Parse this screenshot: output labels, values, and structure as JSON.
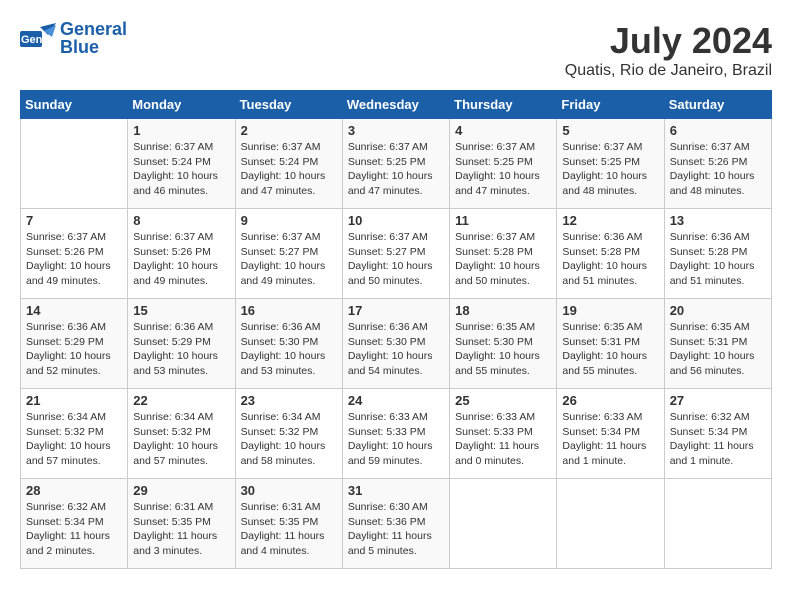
{
  "header": {
    "logo_line1": "General",
    "logo_line2": "Blue",
    "month_year": "July 2024",
    "location": "Quatis, Rio de Janeiro, Brazil"
  },
  "days_of_week": [
    "Sunday",
    "Monday",
    "Tuesday",
    "Wednesday",
    "Thursday",
    "Friday",
    "Saturday"
  ],
  "weeks": [
    [
      {
        "day": "",
        "info": ""
      },
      {
        "day": "1",
        "info": "Sunrise: 6:37 AM\nSunset: 5:24 PM\nDaylight: 10 hours\nand 46 minutes."
      },
      {
        "day": "2",
        "info": "Sunrise: 6:37 AM\nSunset: 5:24 PM\nDaylight: 10 hours\nand 47 minutes."
      },
      {
        "day": "3",
        "info": "Sunrise: 6:37 AM\nSunset: 5:25 PM\nDaylight: 10 hours\nand 47 minutes."
      },
      {
        "day": "4",
        "info": "Sunrise: 6:37 AM\nSunset: 5:25 PM\nDaylight: 10 hours\nand 47 minutes."
      },
      {
        "day": "5",
        "info": "Sunrise: 6:37 AM\nSunset: 5:25 PM\nDaylight: 10 hours\nand 48 minutes."
      },
      {
        "day": "6",
        "info": "Sunrise: 6:37 AM\nSunset: 5:26 PM\nDaylight: 10 hours\nand 48 minutes."
      }
    ],
    [
      {
        "day": "7",
        "info": "Sunrise: 6:37 AM\nSunset: 5:26 PM\nDaylight: 10 hours\nand 49 minutes."
      },
      {
        "day": "8",
        "info": "Sunrise: 6:37 AM\nSunset: 5:26 PM\nDaylight: 10 hours\nand 49 minutes."
      },
      {
        "day": "9",
        "info": "Sunrise: 6:37 AM\nSunset: 5:27 PM\nDaylight: 10 hours\nand 49 minutes."
      },
      {
        "day": "10",
        "info": "Sunrise: 6:37 AM\nSunset: 5:27 PM\nDaylight: 10 hours\nand 50 minutes."
      },
      {
        "day": "11",
        "info": "Sunrise: 6:37 AM\nSunset: 5:28 PM\nDaylight: 10 hours\nand 50 minutes."
      },
      {
        "day": "12",
        "info": "Sunrise: 6:36 AM\nSunset: 5:28 PM\nDaylight: 10 hours\nand 51 minutes."
      },
      {
        "day": "13",
        "info": "Sunrise: 6:36 AM\nSunset: 5:28 PM\nDaylight: 10 hours\nand 51 minutes."
      }
    ],
    [
      {
        "day": "14",
        "info": "Sunrise: 6:36 AM\nSunset: 5:29 PM\nDaylight: 10 hours\nand 52 minutes."
      },
      {
        "day": "15",
        "info": "Sunrise: 6:36 AM\nSunset: 5:29 PM\nDaylight: 10 hours\nand 53 minutes."
      },
      {
        "day": "16",
        "info": "Sunrise: 6:36 AM\nSunset: 5:30 PM\nDaylight: 10 hours\nand 53 minutes."
      },
      {
        "day": "17",
        "info": "Sunrise: 6:36 AM\nSunset: 5:30 PM\nDaylight: 10 hours\nand 54 minutes."
      },
      {
        "day": "18",
        "info": "Sunrise: 6:35 AM\nSunset: 5:30 PM\nDaylight: 10 hours\nand 55 minutes."
      },
      {
        "day": "19",
        "info": "Sunrise: 6:35 AM\nSunset: 5:31 PM\nDaylight: 10 hours\nand 55 minutes."
      },
      {
        "day": "20",
        "info": "Sunrise: 6:35 AM\nSunset: 5:31 PM\nDaylight: 10 hours\nand 56 minutes."
      }
    ],
    [
      {
        "day": "21",
        "info": "Sunrise: 6:34 AM\nSunset: 5:32 PM\nDaylight: 10 hours\nand 57 minutes."
      },
      {
        "day": "22",
        "info": "Sunrise: 6:34 AM\nSunset: 5:32 PM\nDaylight: 10 hours\nand 57 minutes."
      },
      {
        "day": "23",
        "info": "Sunrise: 6:34 AM\nSunset: 5:32 PM\nDaylight: 10 hours\nand 58 minutes."
      },
      {
        "day": "24",
        "info": "Sunrise: 6:33 AM\nSunset: 5:33 PM\nDaylight: 10 hours\nand 59 minutes."
      },
      {
        "day": "25",
        "info": "Sunrise: 6:33 AM\nSunset: 5:33 PM\nDaylight: 11 hours\nand 0 minutes."
      },
      {
        "day": "26",
        "info": "Sunrise: 6:33 AM\nSunset: 5:34 PM\nDaylight: 11 hours\nand 1 minute."
      },
      {
        "day": "27",
        "info": "Sunrise: 6:32 AM\nSunset: 5:34 PM\nDaylight: 11 hours\nand 1 minute."
      }
    ],
    [
      {
        "day": "28",
        "info": "Sunrise: 6:32 AM\nSunset: 5:34 PM\nDaylight: 11 hours\nand 2 minutes."
      },
      {
        "day": "29",
        "info": "Sunrise: 6:31 AM\nSunset: 5:35 PM\nDaylight: 11 hours\nand 3 minutes."
      },
      {
        "day": "30",
        "info": "Sunrise: 6:31 AM\nSunset: 5:35 PM\nDaylight: 11 hours\nand 4 minutes."
      },
      {
        "day": "31",
        "info": "Sunrise: 6:30 AM\nSunset: 5:36 PM\nDaylight: 11 hours\nand 5 minutes."
      },
      {
        "day": "",
        "info": ""
      },
      {
        "day": "",
        "info": ""
      },
      {
        "day": "",
        "info": ""
      }
    ]
  ]
}
